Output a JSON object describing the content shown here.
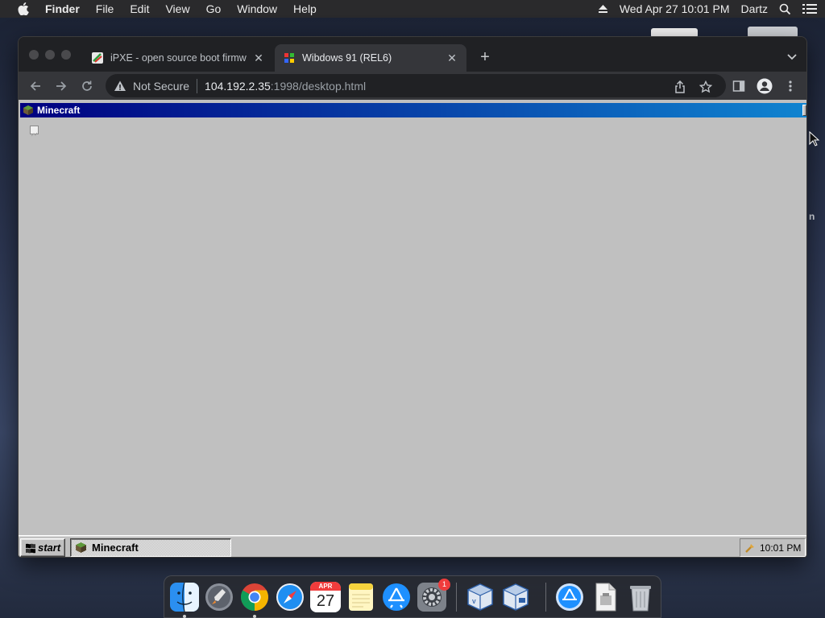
{
  "menubar": {
    "app_name": "Finder",
    "items": [
      "File",
      "Edit",
      "View",
      "Go",
      "Window",
      "Help"
    ],
    "clock": "Wed Apr 27  10:01 PM",
    "user": "Dartz"
  },
  "desktop": {
    "partial_label": "n"
  },
  "browser": {
    "tabs": [
      {
        "title": "iPXE - open source boot firmw",
        "active": false
      },
      {
        "title": "Wibdows 91 (REL6)",
        "active": true
      }
    ],
    "address": {
      "security_label": "Not Secure",
      "host": "104.192.2.35",
      "path": ":1998/desktop.html"
    }
  },
  "webpage": {
    "window_title": "Minecraft",
    "start_label": "start",
    "task_label": "Minecraft",
    "tray_time": "10:01 PM"
  },
  "dock": {
    "calendar_month": "APR",
    "calendar_day": "27",
    "settings_badge": "1",
    "apps": [
      "finder",
      "launchpad",
      "chrome",
      "safari",
      "calendar",
      "notes",
      "app-store",
      "system-preferences",
      "virtualbox",
      "virtualbox-vm",
      "app-store-downloads",
      "document",
      "trash"
    ]
  }
}
